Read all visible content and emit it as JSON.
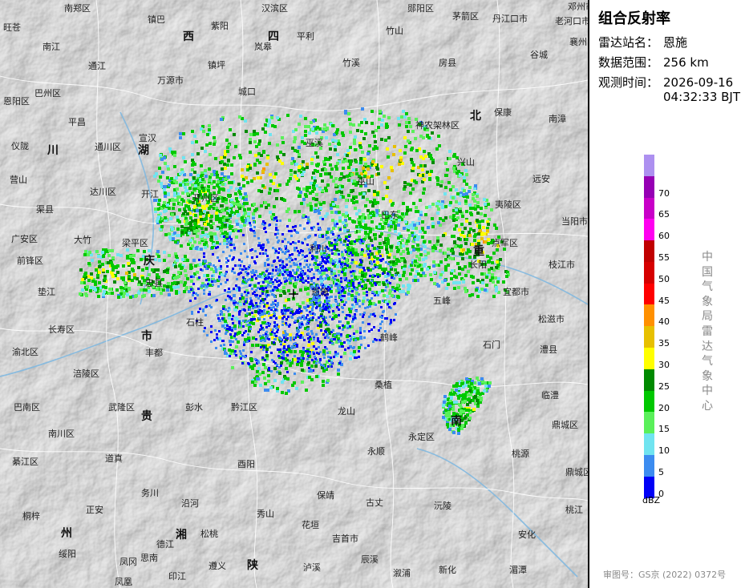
{
  "panel": {
    "title": "组合反射率",
    "station_key": "雷达站名：",
    "station": "恩施",
    "range_key": "数据范围：",
    "range": "256 km",
    "time_key": "观测时间：",
    "date": "2026-09-16",
    "time": "04:32:33 BJT",
    "legend_unit": "dBZ",
    "organization": "中国气象局雷达气象中心",
    "approval_number": "审图号：GS京 (2022) 0372号"
  },
  "legend": [
    {
      "value": null,
      "color": "#ad90f0"
    },
    {
      "value": "70",
      "color": "#9600b4"
    },
    {
      "value": "65",
      "color": "#c800c8"
    },
    {
      "value": "60",
      "color": "#ff00f0"
    },
    {
      "value": "55",
      "color": "#c00000"
    },
    {
      "value": "50",
      "color": "#d60000"
    },
    {
      "value": "45",
      "color": "#ff0000"
    },
    {
      "value": "40",
      "color": "#ff9000"
    },
    {
      "value": "35",
      "color": "#e7c000"
    },
    {
      "value": "30",
      "color": "#ffff00"
    },
    {
      "value": "25",
      "color": "#008a00"
    },
    {
      "value": "20",
      "color": "#00c800"
    },
    {
      "value": "15",
      "color": "#5af05a"
    },
    {
      "value": "10",
      "color": "#70e4f0"
    },
    {
      "value": "5",
      "color": "#3c8cf0"
    },
    {
      "value": "0",
      "color": "#0000f6"
    }
  ],
  "map": {
    "radar_center_label": "恩施",
    "place_labels": [
      "南郑区",
      "镇巴",
      "汉滨区",
      "郧阳区",
      "茅箭区",
      "丹江口市",
      "邓州市",
      "旺苍",
      "紫阳",
      "平利",
      "竹山",
      "老河口市",
      "南江",
      "岚皋",
      "竹溪",
      "房县",
      "谷城",
      "襄州区",
      "通江",
      "万源市",
      "巴州区",
      "镇坪",
      "城口",
      "保康",
      "南漳",
      "恩阳区",
      "平昌",
      "神农架林区",
      "仪陇",
      "通川区",
      "宣汉",
      "巫溪",
      "兴山",
      "营山",
      "达川区",
      "远安",
      "开江",
      "开州区",
      "巫山",
      "夷陵区",
      "渠县",
      "巴东",
      "当阳市",
      "广安区",
      "大竹",
      "梁平区",
      "利川",
      "点军区",
      "前锋区",
      "长阳",
      "枝江市",
      "垫江",
      "忠县",
      "宜都市",
      "五峰",
      "松滋市",
      "长寿区",
      "石柱",
      "鹤峰",
      "石门",
      "渝北区",
      "丰都",
      "澧县",
      "涪陵区",
      "桑植",
      "临澧",
      "巴南区",
      "武隆区",
      "彭水",
      "黔江区",
      "龙山",
      "鼎城区",
      "南川区",
      "永定区",
      "綦江区",
      "道真",
      "酉阳",
      "永顺",
      "桃源",
      "务川",
      "保靖",
      "古丈",
      "沅陵",
      "鼎城区",
      "正安",
      "沿河",
      "秀山",
      "花垣",
      "桃江",
      "桐梓",
      "吉首市",
      "安化",
      "绥阳",
      "凤冈",
      "德江",
      "松桃",
      "凤凰",
      "泸溪",
      "辰溪",
      "溆浦",
      "新化",
      "湄潭",
      "思南",
      "印江",
      "遵义",
      "陕",
      "西",
      "四",
      "川",
      "湖",
      "北",
      "重",
      "庆",
      "市",
      "贵",
      "州",
      "湘",
      "南"
    ]
  }
}
